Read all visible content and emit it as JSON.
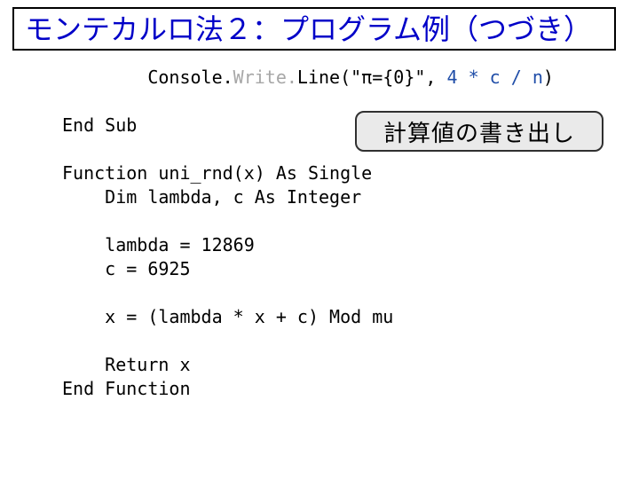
{
  "title": "モンテカルロ法２：プログラム例（つづき）",
  "callout": "計算値の書き出し",
  "code": {
    "l1a": "        Console.",
    "l1b": "Write.",
    "l1c": "Line(\"π={0}\", ",
    "l1d": "4 * c / n",
    "l1e": ")",
    "l2": "",
    "l3": "End Sub",
    "l4": "",
    "l5": "Function uni_rnd(x) As Single",
    "l6": "    Dim lambda, c As Integer",
    "l7": "",
    "l8": "    lambda = 12869",
    "l9": "    c = 6925",
    "l10": "",
    "l11": "    x = (lambda * x + c) Mod mu",
    "l12": "",
    "l13": "    Return x",
    "l14": "End Function"
  }
}
